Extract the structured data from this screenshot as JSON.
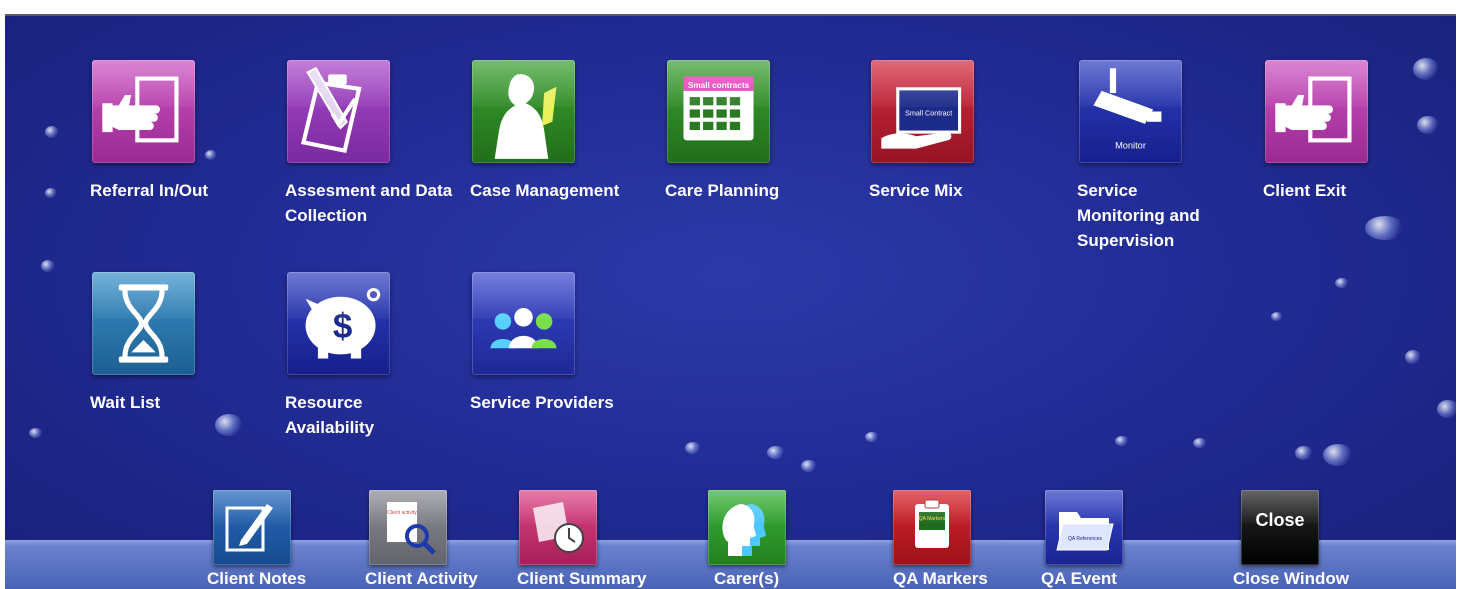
{
  "modules": [
    {
      "id": "referral",
      "label": "Referral In/Out",
      "icon": "hand-pointing-document-icon",
      "color": "#b33aa8"
    },
    {
      "id": "assessment",
      "label": "Assesment and Data Collection",
      "icon": "clipboard-pen-icon",
      "color": "#8e2fb3"
    },
    {
      "id": "case",
      "label": "Case Management",
      "icon": "person-silhouette-icon",
      "color": "#2e8a24"
    },
    {
      "id": "careplanning",
      "label": "Care Planning",
      "icon": "calendar-icon",
      "color": "#2e8a24",
      "icon_text": "Small contracts"
    },
    {
      "id": "servicemix",
      "label": "Service Mix",
      "icon": "hand-holding-card-icon",
      "color": "#b81a2e",
      "icon_text": "Small Contract"
    },
    {
      "id": "monitoring",
      "label": "Service Monitoring and Supervision",
      "icon": "security-camera-icon",
      "color": "#1f2aa6",
      "icon_text": "Monitor"
    },
    {
      "id": "exit",
      "label": "Client Exit",
      "icon": "hand-pointing-document-icon",
      "color": "#b33aa8"
    },
    {
      "id": "waitlist",
      "label": "Wait List",
      "icon": "hourglass-icon",
      "color": "#2a7bb0"
    },
    {
      "id": "resource",
      "label": "Resource Availability",
      "icon": "piggy-bank-icon",
      "color": "#1f2aa6"
    },
    {
      "id": "providers",
      "label": "Service Providers",
      "icon": "people-group-icon",
      "color": "#2c36b8"
    }
  ],
  "toolbar": [
    {
      "id": "notes",
      "label": "Client Notes",
      "icon": "notepad-pencil-icon",
      "color": "#1e5aa8"
    },
    {
      "id": "activity",
      "label": "Client Activity",
      "icon": "document-magnifier-icon",
      "color": "#7d7d86",
      "icon_text": "Client activity"
    },
    {
      "id": "summary",
      "label": "Client Summary",
      "icon": "clock-document-icon",
      "color": "#c92f72"
    },
    {
      "id": "carers",
      "label": "Carer(s)",
      "icon": "head-profiles-icon",
      "color": "#2f9b2c"
    },
    {
      "id": "qamarkers",
      "label": "QA Markers",
      "icon": "clipboard-check-icon",
      "color": "#c21c24",
      "icon_text": "QA Markers"
    },
    {
      "id": "qaevent",
      "label": "QA Event",
      "icon": "folder-icon",
      "color": "#2230b0",
      "icon_text": "QA References"
    },
    {
      "id": "close",
      "label": "Close Window",
      "icon": "close-icon",
      "color": "#0a0a0a",
      "icon_text": "Close"
    }
  ]
}
